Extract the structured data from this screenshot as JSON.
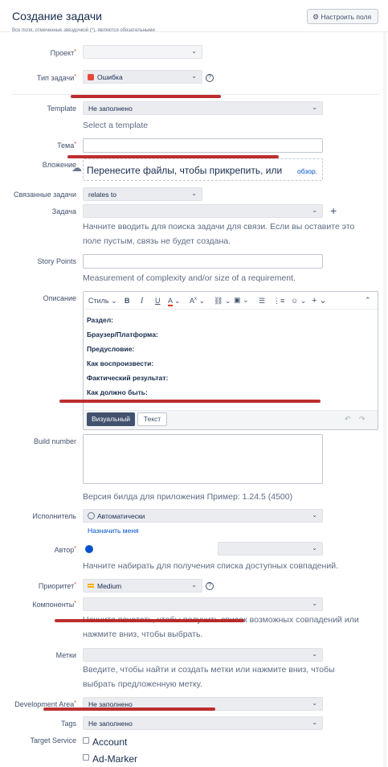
{
  "dialog": {
    "title": "Создание задачи",
    "configure_button": "Настроить поля",
    "required_note": "Все поля, отмеченные звездочкой (*), являются обязательными"
  },
  "fields": {
    "project": {
      "label": "Проект"
    },
    "issue_type": {
      "label": "Тип задачи",
      "value": "Ошибка"
    },
    "template": {
      "label": "Template",
      "value": "Не заполнено",
      "hint": "Select a template"
    },
    "summary": {
      "label": "Тема"
    },
    "attachment": {
      "label": "Вложение",
      "drop_text": "Перенесите файлы, чтобы прикрепить, или",
      "browse": "обзор."
    },
    "linked_issues": {
      "label": "Связанные задачи",
      "value": "relates to"
    },
    "issue": {
      "label": "Задача",
      "hint": "Начните вводить для поиска задачи для связи. Если вы оставите это поле пустым, связь не будет создана."
    },
    "story_points": {
      "label": "Story Points",
      "hint": "Measurement of complexity and/or size of a requirement."
    },
    "description": {
      "label": "Описание",
      "style_menu": "Стиль",
      "lines": [
        "Раздел:",
        "Браузер/Платформа:",
        "Предусловие:",
        "Как воспроизвести:",
        "Фактический результат:",
        "Как должно быть:"
      ],
      "tab_visual": "Визуальный",
      "tab_text": "Текст"
    },
    "build_number": {
      "label": "Build number",
      "hint": "Версия билда для приложения Пример: 1.24.5 (4500)"
    },
    "assignee": {
      "label": "Исполнитель",
      "value": "Автоматически",
      "assign_me": "Назначить меня"
    },
    "reporter": {
      "label": "Автор",
      "hint": "Начните набирать для получения списка доступных совпадений."
    },
    "priority": {
      "label": "Приоритет",
      "value": "Medium"
    },
    "components": {
      "label": "Компоненты",
      "hint": "Начните печатать, чтобы получить список возможных совпадений или нажмите вниз, чтобы выбрать."
    },
    "labels": {
      "label": "Метки",
      "hint": "Введите, чтобы найти и создать метки или нажмите вниз, чтобы выбрать предложенную метку."
    },
    "development_area": {
      "label": "Development Area",
      "value": "Не заполнено"
    },
    "tags": {
      "label": "Tags",
      "value": "Не заполнено"
    },
    "target_service": {
      "label": "Target Service",
      "options": [
        "Account",
        "Ad-Marker"
      ]
    }
  },
  "colors": {
    "annotation_red": "#b71c1c",
    "bug_icon": "#e5493a",
    "link": "#0052cc",
    "priority_medium": "#ffab00"
  }
}
